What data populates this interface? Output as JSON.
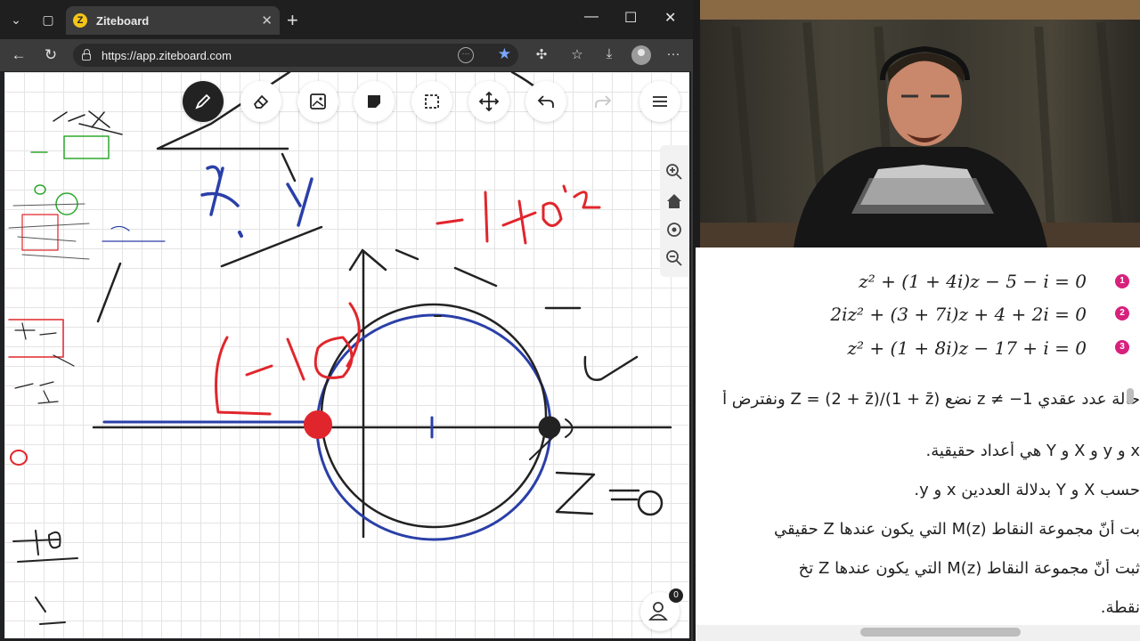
{
  "browser": {
    "tab_title": "Ziteboard",
    "tab_favicon_letter": "Z",
    "url": "https://app.ziteboard.com",
    "window_controls": [
      "minimize",
      "maximize",
      "close"
    ]
  },
  "whiteboard": {
    "tools": [
      {
        "name": "pen-tool",
        "icon": "pencil-icon",
        "active": true
      },
      {
        "name": "eraser-tool",
        "icon": "eraser-icon",
        "active": false
      },
      {
        "name": "image-tool",
        "icon": "image-icon",
        "active": false
      },
      {
        "name": "sticky-note-tool",
        "icon": "sticky-note-icon",
        "active": false
      },
      {
        "name": "select-tool",
        "icon": "select-box-icon",
        "active": false
      },
      {
        "name": "move-tool",
        "icon": "move-arrows-icon",
        "active": false
      },
      {
        "name": "undo-tool",
        "icon": "undo-icon",
        "active": false
      },
      {
        "name": "redo-tool",
        "icon": "redo-icon",
        "active": false
      },
      {
        "name": "menu-tool",
        "icon": "hamburger-menu-icon",
        "active": false
      }
    ],
    "side_controls": [
      "zoom-in-icon",
      "home-icon",
      "center-icon",
      "zoom-out-icon"
    ],
    "share_badge": "0",
    "colors": {
      "ink_black": "#222222",
      "ink_blue": "#2a3fa8",
      "ink_red": "#e0262c",
      "ink_green": "#2ea82e"
    }
  },
  "document": {
    "equations": [
      {
        "num": "1",
        "text": "z² + (1 + 4i)z −  5 −  i = 0"
      },
      {
        "num": "2",
        "text": "2iz² + (3 + 7i)z +  4 + 2i = 0"
      },
      {
        "num": "3",
        "text": "z² + (1 + 8i)z − 17 +  i = 0"
      }
    ],
    "lines": [
      "حالة عدد عقدي z ≠ −1 نضع Z = (2 + z̄)/(1 + z̄) ونفترض أ",
      "x و y و X و Y هي أعداد حقيقية.",
      "حسب X و Y بدلالة العددين x و y.",
      "بت أنّ مجموعة النقاط M(z) التي يكون عندها Z حقيقي",
      "ثبت أنّ مجموعة النقاط M(z) التي يكون عندها Z تخ",
      "نقطة."
    ]
  }
}
